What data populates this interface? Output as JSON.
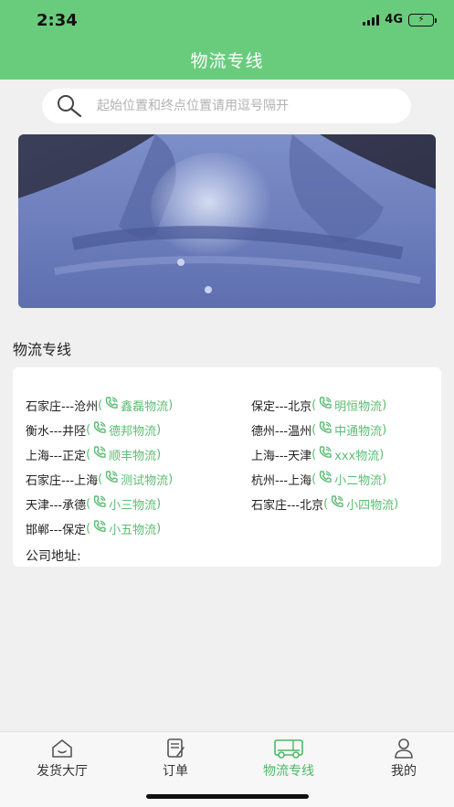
{
  "status": {
    "time": "2:34",
    "network": "4G"
  },
  "header": {
    "title": "物流专线"
  },
  "search": {
    "placeholder": "起始位置和终点位置请用逗号隔开",
    "icon": "search-icon"
  },
  "section_title": "物流专线",
  "routes": [
    {
      "route": "石家庄---沧州",
      "company": "鑫磊物流"
    },
    {
      "route": "保定---北京",
      "company": "明恒物流"
    },
    {
      "route": "衡水---井陉",
      "company": "德邦物流"
    },
    {
      "route": "德州---温州",
      "company": "中通物流"
    },
    {
      "route": "上海---正定",
      "company": "顺丰物流"
    },
    {
      "route": "上海---天津",
      "company": "xxx物流"
    },
    {
      "route": "石家庄---上海",
      "company": "测试物流"
    },
    {
      "route": "杭州---上海",
      "company": "小二物流"
    },
    {
      "route": "天津---承德",
      "company": "小三物流"
    },
    {
      "route": "石家庄---北京",
      "company": "小四物流"
    },
    {
      "route": "邯郸---保定",
      "company": "小五物流"
    }
  ],
  "address_label": "公司地址:",
  "tabs": [
    {
      "label": "发货大厅",
      "icon": "home-icon"
    },
    {
      "label": "订单",
      "icon": "order-icon"
    },
    {
      "label": "物流专线",
      "icon": "truck-icon",
      "active": true
    },
    {
      "label": "我的",
      "icon": "user-icon"
    }
  ],
  "colors": {
    "primary": "#69cc7d",
    "company_text": "#5bbd72",
    "active_tab": "#4cb865"
  }
}
